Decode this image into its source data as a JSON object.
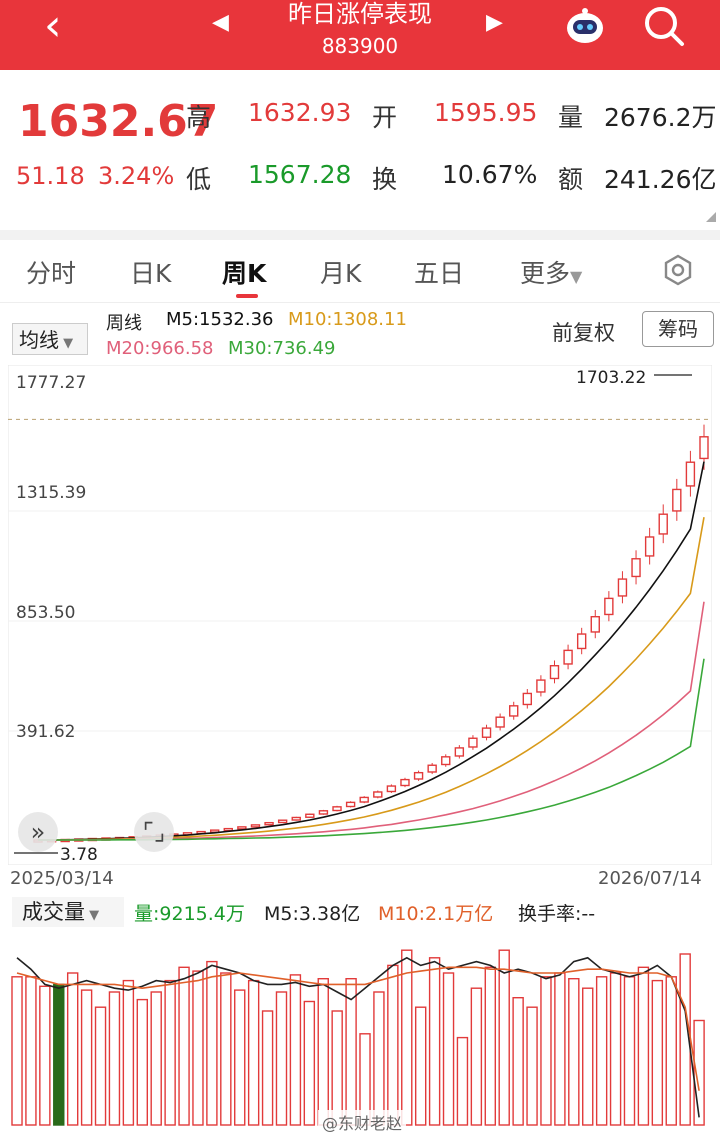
{
  "header": {
    "title": "昨日涨停表现",
    "code": "883900",
    "back_icon": "chevron-left-icon",
    "prev_icon": "triangle-left-icon",
    "next_icon": "triangle-right-icon",
    "robot_icon": "robot-assistant-icon",
    "search_icon": "search-icon"
  },
  "quote": {
    "price": "1632.67",
    "change": "51.18",
    "change_pct": "3.24%",
    "high_label": "高",
    "high": "1632.93",
    "low_label": "低",
    "low": "1567.28",
    "open_label": "开",
    "open": "1595.95",
    "turnover_label": "换",
    "turnover": "10.67%",
    "volume_label": "量",
    "volume": "2676.2万",
    "amount_label": "额",
    "amount": "241.26亿"
  },
  "tabs": [
    "分时",
    "日K",
    "周K",
    "月K",
    "五日",
    "更多"
  ],
  "active_tab": "周K",
  "indicators": {
    "ma_selector": "均线",
    "period": "周线",
    "m5": "M5:1532.36",
    "m10": "M10:1308.11",
    "m20": "M20:966.58",
    "m30": "M30:736.49",
    "adjust": "前复权",
    "chips_button": "筹码",
    "colors": {
      "m5": "#111111",
      "m10": "#d89a1a",
      "m20": "#e0607a",
      "m30": "#3aa83a",
      "up": "#e23a3a",
      "down": "#1a8a2a"
    }
  },
  "chart_data": {
    "type": "candlestick",
    "y_axis_labels": [
      "1777.27",
      "1315.39",
      "853.50",
      "391.62"
    ],
    "ylim": [
      0,
      1777.27
    ],
    "max_annotation": "1703.22",
    "min_annotation": "3.78",
    "start_date": "2025/03/14",
    "end_date": "2026/07/14",
    "candles_close": [
      4,
      5,
      6,
      8,
      10,
      12,
      14,
      17,
      20,
      24,
      28,
      33,
      38,
      44,
      50,
      57,
      65,
      74,
      84,
      95,
      108,
      122,
      138,
      156,
      176,
      198,
      222,
      248,
      276,
      306,
      340,
      376,
      415,
      456,
      500,
      546,
      596,
      650,
      708,
      770,
      836,
      906,
      980,
      1058,
      1140,
      1228,
      1320,
      1420,
      1530,
      1632.67
    ],
    "ma5": [
      4,
      4,
      5,
      6,
      8,
      9,
      11,
      13,
      15,
      18,
      21,
      24,
      29,
      33,
      39,
      45,
      51,
      58,
      66,
      75,
      85,
      96,
      109,
      123,
      139,
      158,
      178,
      200,
      224,
      250,
      278,
      308,
      341,
      375,
      413,
      452,
      494,
      539,
      587,
      639,
      694,
      752,
      812,
      876,
      944,
      1016,
      1092,
      1173,
      1260,
      1532.36
    ],
    "ma10": [
      4,
      4,
      4,
      5,
      6,
      7,
      8,
      10,
      11,
      13,
      15,
      17,
      20,
      23,
      27,
      31,
      35,
      40,
      46,
      52,
      59,
      67,
      76,
      86,
      97,
      110,
      124,
      140,
      157,
      176,
      197,
      220,
      245,
      272,
      301,
      332,
      366,
      402,
      441,
      483,
      527,
      574,
      624,
      678,
      735,
      796,
      860,
      928,
      1000,
      1308.11
    ],
    "ma20": [
      4,
      4,
      4,
      4,
      5,
      5,
      6,
      7,
      8,
      9,
      10,
      11,
      12,
      14,
      16,
      18,
      20,
      23,
      26,
      29,
      33,
      37,
      42,
      47,
      53,
      60,
      67,
      76,
      85,
      95,
      106,
      118,
      131,
      146,
      162,
      180,
      199,
      220,
      243,
      268,
      295,
      324,
      356,
      390,
      427,
      467,
      510,
      556,
      606,
      966.58
    ],
    "ma30": [
      4,
      4,
      4,
      4,
      4,
      4,
      5,
      5,
      5,
      6,
      6,
      7,
      8,
      9,
      10,
      11,
      12,
      13,
      15,
      17,
      19,
      21,
      24,
      27,
      30,
      34,
      38,
      43,
      48,
      54,
      61,
      68,
      76,
      85,
      95,
      106,
      118,
      131,
      145,
      161,
      178,
      197,
      217,
      240,
      264,
      290,
      318,
      349,
      382,
      736.49
    ]
  },
  "volume": {
    "selector": "成交量",
    "current": "量:9215.4万",
    "m5": "M5:3.38亿",
    "m10": "M10:2.1万亿",
    "turnover": "换手率:--",
    "bars": [
      0.78,
      0.78,
      0.73,
      0.74,
      0.8,
      0.71,
      0.62,
      0.7,
      0.76,
      0.66,
      0.7,
      0.76,
      0.83,
      0.81,
      0.86,
      0.8,
      0.71,
      0.76,
      0.6,
      0.7,
      0.79,
      0.65,
      0.77,
      0.6,
      0.77,
      0.48,
      0.7,
      0.84,
      0.92,
      0.62,
      0.88,
      0.8,
      0.46,
      0.72,
      0.83,
      0.92,
      0.67,
      0.62,
      0.78,
      0.8,
      0.77,
      0.72,
      0.78,
      0.8,
      0.78,
      0.83,
      0.76,
      0.78,
      0.9,
      0.55
    ],
    "m5_line": [
      0.88,
      0.82,
      0.74,
      0.72,
      0.74,
      0.76,
      0.74,
      0.72,
      0.71,
      0.73,
      0.76,
      0.75,
      0.77,
      0.8,
      0.84,
      0.82,
      0.8,
      0.76,
      0.74,
      0.74,
      0.75,
      0.73,
      0.74,
      0.7,
      0.66,
      0.72,
      0.78,
      0.84,
      0.88,
      0.84,
      0.86,
      0.82,
      0.84,
      0.86,
      0.84,
      0.8,
      0.82,
      0.8,
      0.77,
      0.79,
      0.86,
      0.88,
      0.82,
      0.8,
      0.78,
      0.8,
      0.84,
      0.78,
      0.6,
      0.04
    ],
    "m10_line": [
      0.8,
      0.78,
      0.76,
      0.74,
      0.74,
      0.74,
      0.74,
      0.74,
      0.73,
      0.72,
      0.73,
      0.74,
      0.75,
      0.76,
      0.78,
      0.79,
      0.8,
      0.79,
      0.78,
      0.77,
      0.76,
      0.75,
      0.74,
      0.74,
      0.74,
      0.74,
      0.76,
      0.78,
      0.8,
      0.81,
      0.82,
      0.83,
      0.83,
      0.83,
      0.82,
      0.82,
      0.81,
      0.8,
      0.8,
      0.8,
      0.81,
      0.82,
      0.82,
      0.81,
      0.8,
      0.8,
      0.8,
      0.78,
      0.62,
      0.18
    ]
  },
  "watermark": "@东财老赵"
}
